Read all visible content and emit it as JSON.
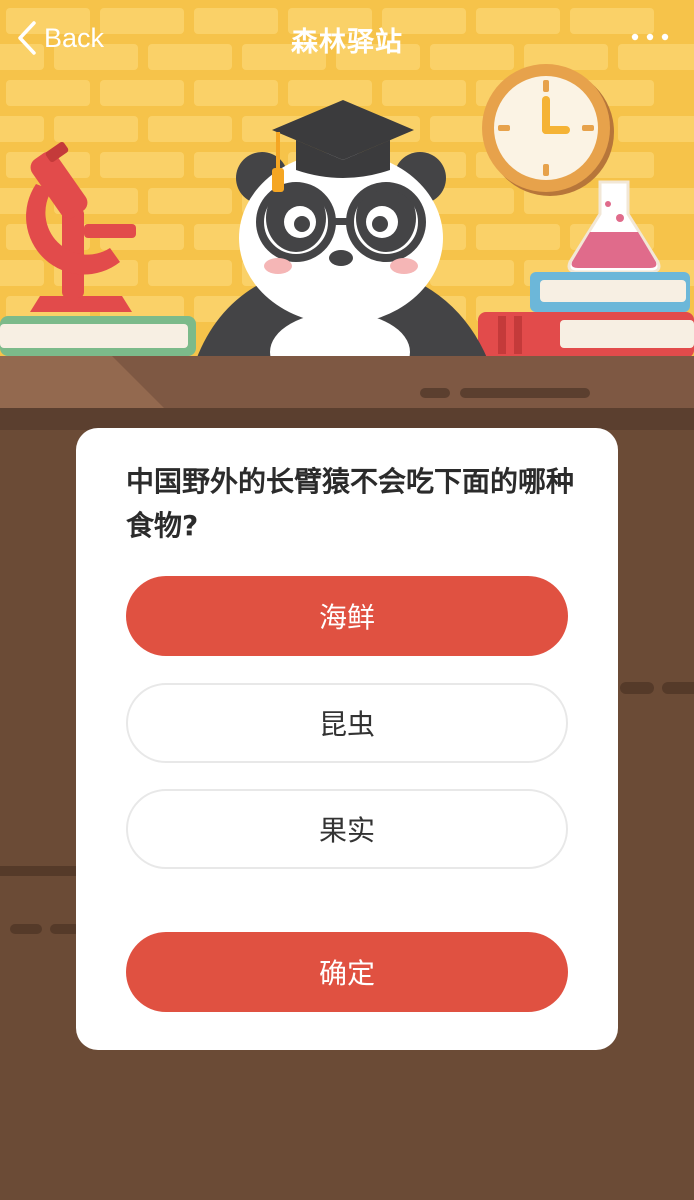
{
  "nav": {
    "back_label": "Back",
    "title": "森林驿站",
    "more_icon": "more-dots-icon"
  },
  "quiz": {
    "question": "中国野外的长臂猿不会吃下面的哪种食物?",
    "options": [
      {
        "label": "海鲜",
        "selected": true
      },
      {
        "label": "昆虫",
        "selected": false
      },
      {
        "label": "果实",
        "selected": false
      }
    ],
    "confirm_label": "确定"
  },
  "colors": {
    "accent": "#e05141",
    "wall": "#f6c34a",
    "desk": "#6b4b36"
  }
}
